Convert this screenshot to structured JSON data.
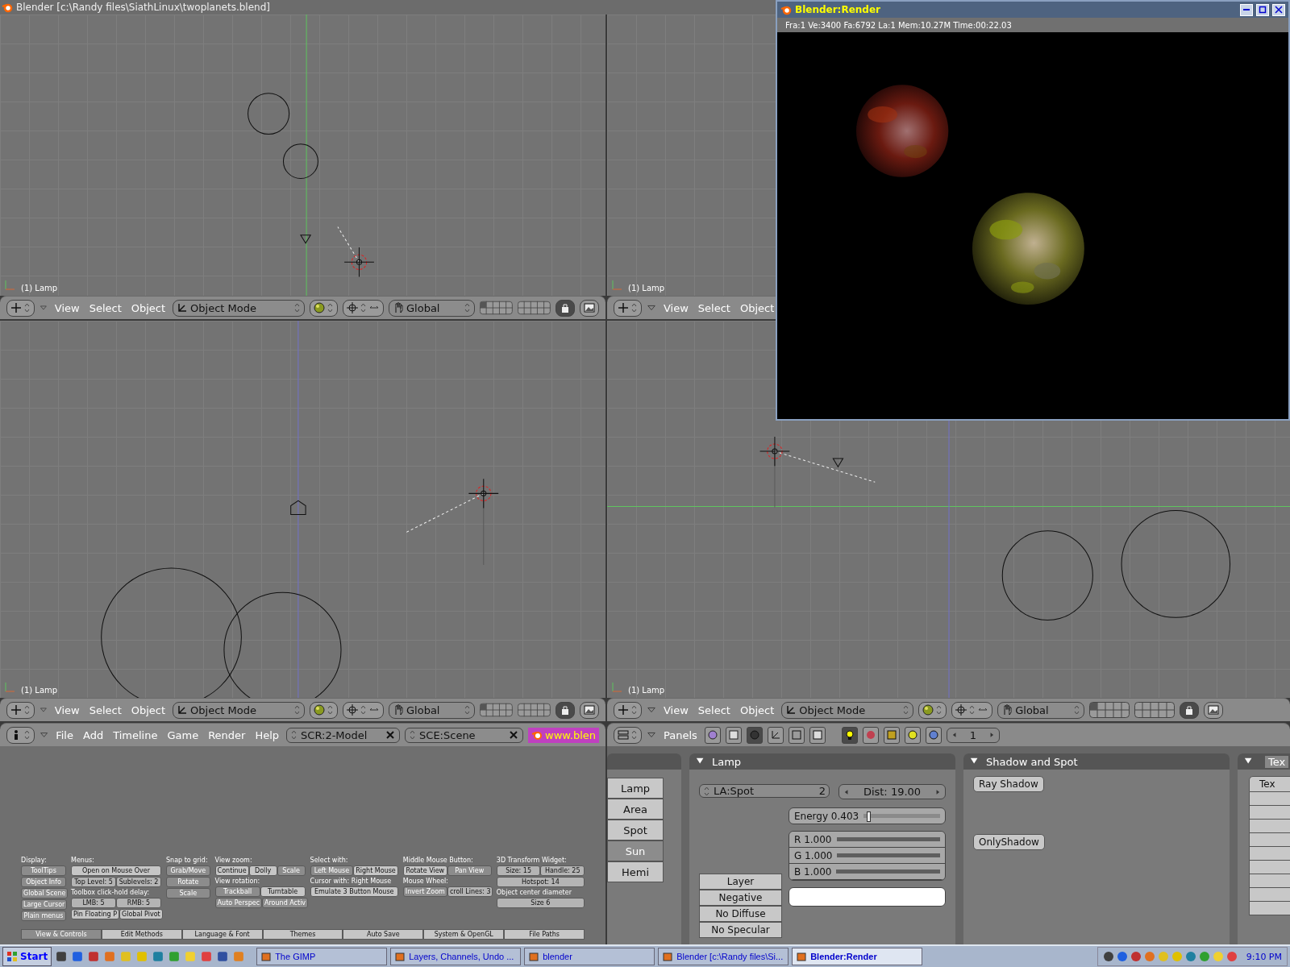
{
  "window": {
    "title": "Blender [c:\\Randy files\\SiathLinux\\twoplanets.blend]"
  },
  "viewports": [
    {
      "label": "(1) Lamp",
      "header": {
        "menus": [
          "View",
          "Select",
          "Object"
        ],
        "mode": "Object Mode",
        "orientation": "Global"
      }
    },
    {
      "label": "(1) Lamp",
      "header": {
        "menus": [
          "View",
          "Select",
          "Object"
        ]
      }
    },
    {
      "label": "(1) Lamp",
      "header": {
        "menus": [
          "View",
          "Select",
          "Object"
        ],
        "mode": "Object Mode",
        "orientation": "Global"
      }
    },
    {
      "label": "(1) Lamp",
      "header": {
        "menus": [
          "View",
          "Select",
          "Object"
        ],
        "mode": "Object Mode",
        "orientation": "Global"
      }
    }
  ],
  "user_preferences": {
    "header": {
      "menus": [
        "File",
        "Add",
        "Timeline",
        "Game",
        "Render",
        "Help"
      ],
      "screen": "SCR:2-Model",
      "scene": "SCE:Scene",
      "link": "www.blen"
    },
    "columns": [
      {
        "rows": [
          {
            "kind": "label",
            "text": "Display:"
          },
          {
            "kind": "buttons",
            "buttons": [
              {
                "text": "ToolTips",
                "kind": "toggle",
                "selected": true
              }
            ]
          },
          {
            "kind": "buttons",
            "buttons": [
              {
                "text": "Object Info",
                "kind": "toggle",
                "selected": true
              }
            ]
          },
          {
            "kind": "buttons",
            "buttons": [
              {
                "text": "Global Scene",
                "kind": "toggle",
                "selected": true
              }
            ]
          },
          {
            "kind": "buttons",
            "buttons": [
              {
                "text": "Large Cursor",
                "kind": "toggle",
                "selected": true
              }
            ]
          },
          {
            "kind": "buttons",
            "buttons": [
              {
                "text": "Plain menus",
                "kind": "toggle",
                "selected": true
              }
            ]
          }
        ]
      },
      {
        "rows": [
          {
            "kind": "label",
            "text": "Menus:"
          },
          {
            "kind": "buttons",
            "buttons": [
              {
                "text": "Open on Mouse Over",
                "kind": "toggle",
                "selected": false
              }
            ]
          },
          {
            "kind": "buttons",
            "buttons": [
              {
                "text": "Top Level: 5",
                "kind": "number"
              },
              {
                "text": "Sublevels: 2",
                "kind": "number"
              }
            ]
          },
          {
            "kind": "label",
            "text": "Toolbox click-hold delay:"
          },
          {
            "kind": "buttons",
            "buttons": [
              {
                "text": "LMB: 5",
                "kind": "number"
              },
              {
                "text": "RMB: 5",
                "kind": "number"
              }
            ]
          },
          {
            "kind": "buttons",
            "buttons": [
              {
                "text": "Pin Floating P",
                "kind": "toggle",
                "selected": false
              },
              {
                "text": "Global Pivot",
                "kind": "toggle",
                "selected": false
              }
            ]
          }
        ]
      },
      {
        "rows": [
          {
            "kind": "label",
            "text": "Snap to grid:"
          },
          {
            "kind": "buttons",
            "buttons": [
              {
                "text": "Grab/Move",
                "kind": "toggle",
                "selected": true
              }
            ]
          },
          {
            "kind": "buttons",
            "buttons": [
              {
                "text": "Rotate",
                "kind": "toggle",
                "selected": true
              }
            ]
          },
          {
            "kind": "buttons",
            "buttons": [
              {
                "text": "Scale",
                "kind": "toggle",
                "selected": true
              }
            ]
          }
        ]
      },
      {
        "rows": [
          {
            "kind": "label",
            "text": "View zoom:"
          },
          {
            "kind": "buttons",
            "buttons": [
              {
                "text": "Continue",
                "kind": "toggle",
                "selected": false
              },
              {
                "text": "Dolly",
                "kind": "toggle",
                "selected": false
              },
              {
                "text": "Scale",
                "kind": "toggle",
                "selected": true
              }
            ]
          },
          {
            "kind": "label",
            "text": "View rotation:"
          },
          {
            "kind": "buttons",
            "buttons": [
              {
                "text": "Trackball",
                "kind": "toggle",
                "selected": true
              },
              {
                "text": "Turntable",
                "kind": "toggle",
                "selected": false
              }
            ]
          },
          {
            "kind": "buttons",
            "buttons": [
              {
                "text": "Auto Perspec",
                "kind": "toggle",
                "selected": true
              },
              {
                "text": "Around Activ",
                "kind": "toggle",
                "selected": true
              }
            ]
          }
        ]
      },
      {
        "rows": [
          {
            "kind": "label",
            "text": "Select with:"
          },
          {
            "kind": "buttons",
            "buttons": [
              {
                "text": "Left Mouse",
                "kind": "toggle",
                "selected": true
              },
              {
                "text": "Right Mouse",
                "kind": "toggle",
                "selected": false
              }
            ]
          },
          {
            "kind": "label",
            "text": "Cursor with: Right Mouse"
          },
          {
            "kind": "buttons",
            "buttons": [
              {
                "text": "Emulate 3 Button Mouse",
                "kind": "toggle",
                "selected": false
              }
            ]
          }
        ]
      },
      {
        "rows": [
          {
            "kind": "label",
            "text": "Middle Mouse Button:"
          },
          {
            "kind": "buttons",
            "buttons": [
              {
                "text": "Rotate View",
                "kind": "toggle",
                "selected": false
              },
              {
                "text": "Pan View",
                "kind": "toggle",
                "selected": true
              }
            ]
          },
          {
            "kind": "label",
            "text": "Mouse Wheel:"
          },
          {
            "kind": "buttons",
            "buttons": [
              {
                "text": "Invert Zoom",
                "kind": "toggle",
                "selected": true
              },
              {
                "text": "croll Lines: 3",
                "kind": "number"
              }
            ]
          }
        ]
      },
      {
        "rows": [
          {
            "kind": "label",
            "text": "3D Transform Widget:"
          },
          {
            "kind": "buttons",
            "buttons": [
              {
                "text": "Size: 15",
                "kind": "number"
              },
              {
                "text": "Handle: 25",
                "kind": "number"
              }
            ]
          },
          {
            "kind": "buttons",
            "buttons": [
              {
                "text": "Hotspot: 14",
                "kind": "number"
              }
            ]
          },
          {
            "kind": "label",
            "text": "Object center diameter"
          },
          {
            "kind": "buttons",
            "buttons": [
              {
                "text": "Size 6",
                "kind": "number"
              }
            ]
          }
        ]
      }
    ],
    "tabs": [
      {
        "label": "View & Controls",
        "selected": true
      },
      {
        "label": "Edit Methods",
        "selected": false
      },
      {
        "label": "Language & Font",
        "selected": false
      },
      {
        "label": "Themes",
        "selected": false
      },
      {
        "label": "Auto Save",
        "selected": false
      },
      {
        "label": "System & OpenGL",
        "selected": false
      },
      {
        "label": "File Paths",
        "selected": false
      }
    ]
  },
  "buttons_window": {
    "header": {
      "label": "Panels",
      "frame": "1"
    },
    "lamp_types": [
      {
        "label": "Lamp",
        "selected": false
      },
      {
        "label": "Area",
        "selected": false
      },
      {
        "label": "Spot",
        "selected": false
      },
      {
        "label": "Sun",
        "selected": true
      },
      {
        "label": "Hemi",
        "selected": false
      }
    ],
    "lamp": {
      "title": "Lamp",
      "name": "LA:Spot",
      "users": "2",
      "dist": "Dist: 19.00",
      "energy": {
        "text": "Energy 0.403",
        "level": 0.04
      },
      "colors": [
        {
          "text": "R 1.000",
          "level": 1
        },
        {
          "text": "G 1.000",
          "level": 1
        },
        {
          "text": "B 1.000",
          "level": 1
        }
      ],
      "toggles": [
        {
          "label": "Layer",
          "selected": false
        },
        {
          "label": "Negative",
          "selected": false
        },
        {
          "label": "No Diffuse",
          "selected": false
        },
        {
          "label": "No Specular",
          "selected": false
        }
      ]
    },
    "shadow": {
      "title": "Shadow and Spot",
      "toggles": [
        {
          "label": "Ray Shadow",
          "selected": false
        },
        {
          "label": "OnlyShadow",
          "selected": false
        }
      ]
    },
    "texture": {
      "title": "Tex",
      "button": "Tex"
    }
  },
  "render_window": {
    "title": "Blender:Render",
    "stats": "Fra:1  Ve:3400 Fa:6792 La:1 Mem:10.27M Time:00:22.03"
  },
  "taskbar": {
    "start": "Start",
    "tasks": [
      {
        "label": "The GIMP",
        "selected": false
      },
      {
        "label": "Layers, Channels, Undo ...",
        "selected": false
      },
      {
        "label": "blender",
        "selected": false
      },
      {
        "label": "Blender [c:\\Randy files\\Si...",
        "selected": false
      },
      {
        "label": "Blender:Render",
        "selected": true
      }
    ],
    "clock": "9:10 PM"
  }
}
